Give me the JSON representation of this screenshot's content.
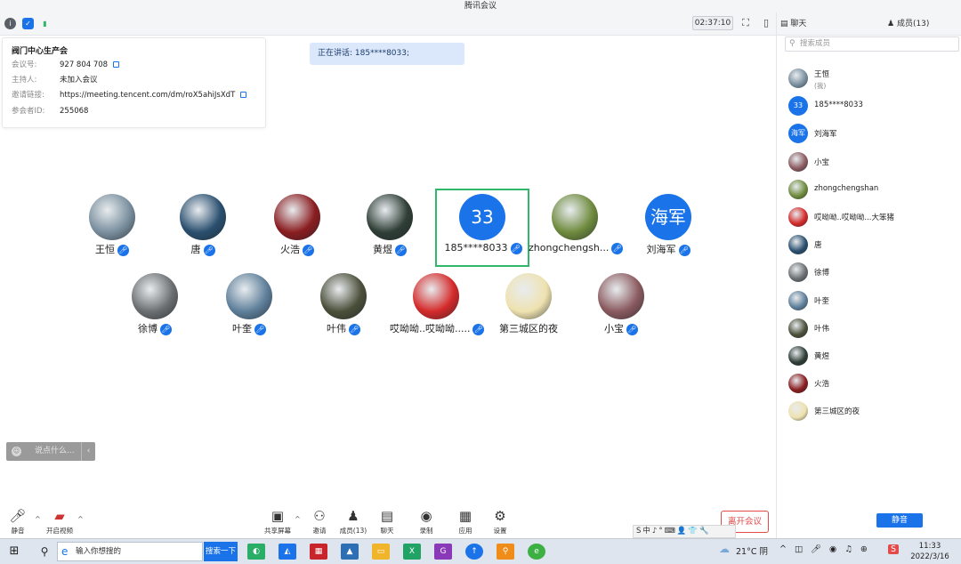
{
  "window": {
    "title": "腾讯会议"
  },
  "topbar": {
    "timer": "02:37:10"
  },
  "meeting_info": {
    "title": "阀门中心生产会",
    "rows": [
      {
        "label": "会议号:",
        "value": "927 804 708",
        "copy": true
      },
      {
        "label": "主持人:",
        "value": "未加入会议",
        "copy": false
      },
      {
        "label": "邀请链接:",
        "value": "https://meeting.tencent.com/dm/roX5ahiJsXdT",
        "copy": true
      },
      {
        "label": "参会者ID:",
        "value": "255068",
        "copy": false
      }
    ]
  },
  "speaking": {
    "text": "正在讲话: 185****8033;"
  },
  "participants_row1": [
    {
      "name": "王恒",
      "avatar": "photo",
      "color": "#7a8f9e",
      "mic": true
    },
    {
      "name": "唐",
      "avatar": "photo",
      "color": "#2a4f6f",
      "mic": true
    },
    {
      "name": "火浩",
      "avatar": "photo",
      "color": "#8a1d20",
      "mic": true
    },
    {
      "name": "黄煜",
      "avatar": "photo",
      "color": "#2f3e36",
      "mic": true
    },
    {
      "name": "185****8033",
      "avatar": "text",
      "initials": "33",
      "color": "#1a73e8",
      "mic": true,
      "active": true
    },
    {
      "name": "zhongchengsh...",
      "avatar": "photo",
      "color": "#6f8b3e",
      "mic": true
    },
    {
      "name": "刘海军",
      "avatar": "text",
      "initials": "海军",
      "color": "#1a73e8",
      "mic": true
    }
  ],
  "participants_row2": [
    {
      "name": "徐博",
      "avatar": "photo",
      "color": "#6b6f72",
      "mic": true
    },
    {
      "name": "叶奎",
      "avatar": "photo",
      "color": "#5e7f9a",
      "mic": true
    },
    {
      "name": "叶伟",
      "avatar": "photo",
      "color": "#4b4f3a",
      "mic": true
    },
    {
      "name": "哎呦呦..哎呦呦.....",
      "avatar": "photo",
      "color": "#d42a2a",
      "mic": true
    },
    {
      "name": "第三城区的夜",
      "avatar": "photo",
      "color": "#efe2b0",
      "mic": false
    },
    {
      "name": "小宝",
      "avatar": "photo",
      "color": "#8a5a5f",
      "mic": true
    }
  ],
  "chat_input": {
    "placeholder": "说点什么..."
  },
  "bottombar": {
    "mute": "静音",
    "video": "开启视频",
    "share": "共享屏幕",
    "invite": "邀请",
    "members": "成员(13)",
    "chat": "聊天",
    "record": "录制",
    "apps": "应用",
    "settings": "设置",
    "leave": "离开会议"
  },
  "sidepanel": {
    "tab_chat": "聊天",
    "tab_members": "成员(13)",
    "search_placeholder": "搜索成员",
    "members": [
      {
        "name": "王恒",
        "sub": "(我)",
        "avatar": "photo",
        "color": "#7a8f9e"
      },
      {
        "name": "185****8033",
        "avatar": "text",
        "initials": "33",
        "color": "#1a73e8"
      },
      {
        "name": "刘海军",
        "avatar": "text",
        "initials": "海军",
        "color": "#1a73e8"
      },
      {
        "name": "小宝",
        "avatar": "photo",
        "color": "#8a5a5f"
      },
      {
        "name": "zhongchengshan",
        "avatar": "photo",
        "color": "#6f8b3e"
      },
      {
        "name": "哎呦呦..哎呦呦...大笨猪",
        "avatar": "photo",
        "color": "#d42a2a"
      },
      {
        "name": "唐",
        "avatar": "photo",
        "color": "#2a4f6f"
      },
      {
        "name": "徐博",
        "avatar": "photo",
        "color": "#6b6f72"
      },
      {
        "name": "叶奎",
        "avatar": "photo",
        "color": "#5e7f9a"
      },
      {
        "name": "叶伟",
        "avatar": "photo",
        "color": "#4b4f3a"
      },
      {
        "name": "黄煜",
        "avatar": "photo",
        "color": "#2f3e36"
      },
      {
        "name": "火浩",
        "avatar": "photo",
        "color": "#8a1d20"
      },
      {
        "name": "第三城区的夜",
        "avatar": "photo",
        "color": "#efe2b0"
      }
    ],
    "mute_all": "静音"
  },
  "ime_bar": {
    "text": "S中♪°⌨👤👕🔧"
  },
  "taskbar": {
    "search_placeholder": "输入你想搜的",
    "search_button": "搜索一下",
    "weather": "21°C 阴",
    "time": "11:33",
    "date": "2022/3/16"
  }
}
